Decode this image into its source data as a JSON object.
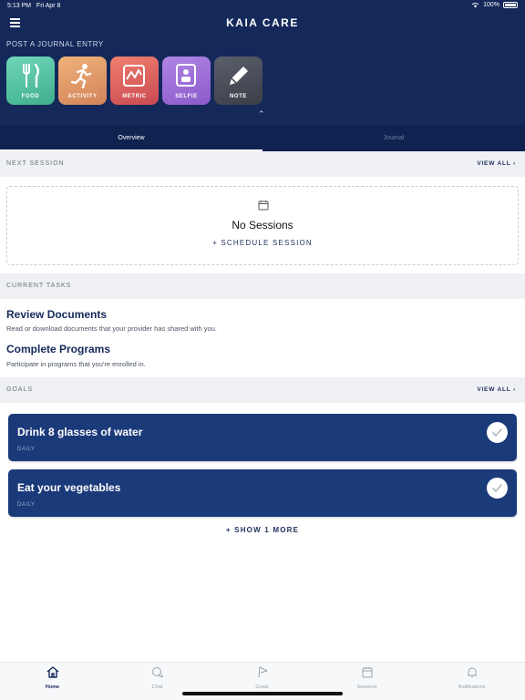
{
  "status_bar": {
    "time": "5:13 PM",
    "date": "Fri Apr 8",
    "battery": "100%"
  },
  "header": {
    "title": "KAIA CARE"
  },
  "journal": {
    "label": "POST A JOURNAL ENTRY",
    "tiles": [
      {
        "label": "FOOD",
        "icon": "fork-knife-icon"
      },
      {
        "label": "ACTIVITY",
        "icon": "running-person-icon"
      },
      {
        "label": "METRIC",
        "icon": "chart-icon"
      },
      {
        "label": "SELFIE",
        "icon": "selfie-icon"
      },
      {
        "label": "NOTE",
        "icon": "pencil-icon"
      }
    ]
  },
  "tabs": [
    {
      "label": "Overview",
      "active": true
    },
    {
      "label": "Journal",
      "active": false
    }
  ],
  "next_session": {
    "title": "NEXT SESSION",
    "view_all": "VIEW ALL",
    "empty_text": "No Sessions",
    "schedule_label": "+ SCHEDULE SESSION"
  },
  "current_tasks": {
    "title": "CURRENT TASKS",
    "items": [
      {
        "title": "Review Documents",
        "description": "Read or download documents that your provider has shared with you."
      },
      {
        "title": "Complete Programs",
        "description": "Participate in programs that you're enrolled in."
      }
    ]
  },
  "goals": {
    "title": "GOALS",
    "view_all": "VIEW ALL",
    "items": [
      {
        "title": "Drink 8 glasses of water",
        "frequency": "DAILY"
      },
      {
        "title": "Eat your vegetables",
        "frequency": "DAILY"
      }
    ],
    "show_more": "+ SHOW 1 MORE"
  },
  "bottom_nav": [
    {
      "label": "Home",
      "icon": "home-icon",
      "active": true
    },
    {
      "label": "Chat",
      "icon": "chat-icon",
      "active": false
    },
    {
      "label": "Goals",
      "icon": "flag-icon",
      "active": false
    },
    {
      "label": "Sessions",
      "icon": "calendar-icon",
      "active": false
    },
    {
      "label": "Notifications",
      "icon": "bell-icon",
      "active": false
    }
  ],
  "colors": {
    "navy": "#14295a",
    "goal_card": "#1b3a7a",
    "section_bg": "#eef0f3"
  }
}
